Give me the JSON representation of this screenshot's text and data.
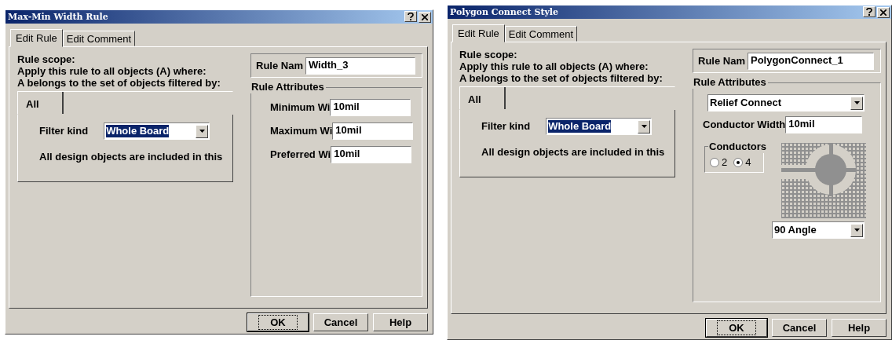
{
  "dialogs": [
    {
      "kind": "width",
      "title": "Max-Min Width Rule",
      "tabs": [
        {
          "label": "Edit Rule",
          "selected": true
        },
        {
          "label": "Edit Comment",
          "selected": false
        }
      ],
      "scope_lines": [
        "Rule scope:",
        "Apply this rule to all objects (A) where:",
        "A belongs to the set of objects filtered by:"
      ],
      "filter_tabs": [
        {
          "label": "All",
          "selected": true
        }
      ],
      "filter_kind": {
        "label": "Filter kind",
        "value": "Whole Board",
        "highlighted": true
      },
      "filter_note": "All design objects are included in this",
      "rule_name": {
        "label": "Rule Nam",
        "value": "Width_3"
      },
      "attributes_title": "Rule Attributes",
      "attributes": [
        {
          "kind": "field",
          "label": "Minimum Wi",
          "value": "10mil"
        },
        {
          "kind": "field",
          "label": "Maximum Wi",
          "value": "10mil"
        },
        {
          "kind": "field",
          "label": "Preferred Wi",
          "value": "10mil"
        }
      ],
      "buttons": [
        {
          "label": "OK",
          "default": true
        },
        {
          "label": "Cancel",
          "default": false
        },
        {
          "label": "Help",
          "default": false
        }
      ]
    },
    {
      "kind": "polygon",
      "title": "Polygon Connect Style",
      "tabs": [
        {
          "label": "Edit Rule",
          "selected": true
        },
        {
          "label": "Edit Comment",
          "selected": false
        }
      ],
      "scope_lines": [
        "Rule scope:",
        "Apply this rule to all objects (A) where:",
        "A belongs to the set of objects filtered by:"
      ],
      "filter_tabs": [
        {
          "label": "All",
          "selected": true
        }
      ],
      "filter_kind": {
        "label": "Filter kind",
        "value": "Whole Board",
        "highlighted": true
      },
      "filter_note": "All design objects are included in this",
      "rule_name": {
        "label": "Rule Nam",
        "value": "PolygonConnect_1"
      },
      "attributes_title": "Rule Attributes",
      "attributes": [
        {
          "kind": "select",
          "value": "Relief Connect"
        },
        {
          "kind": "field",
          "label": "Conductor Width",
          "value": "10mil"
        },
        {
          "kind": "conductors",
          "title": "Conductors",
          "options": [
            {
              "label": "2",
              "selected": false
            },
            {
              "label": "4",
              "selected": true
            }
          ],
          "angle": "90 Angle"
        }
      ],
      "buttons": [
        {
          "label": "OK",
          "default": true
        },
        {
          "label": "Cancel",
          "default": false
        },
        {
          "label": "Help",
          "default": false
        }
      ]
    }
  ]
}
